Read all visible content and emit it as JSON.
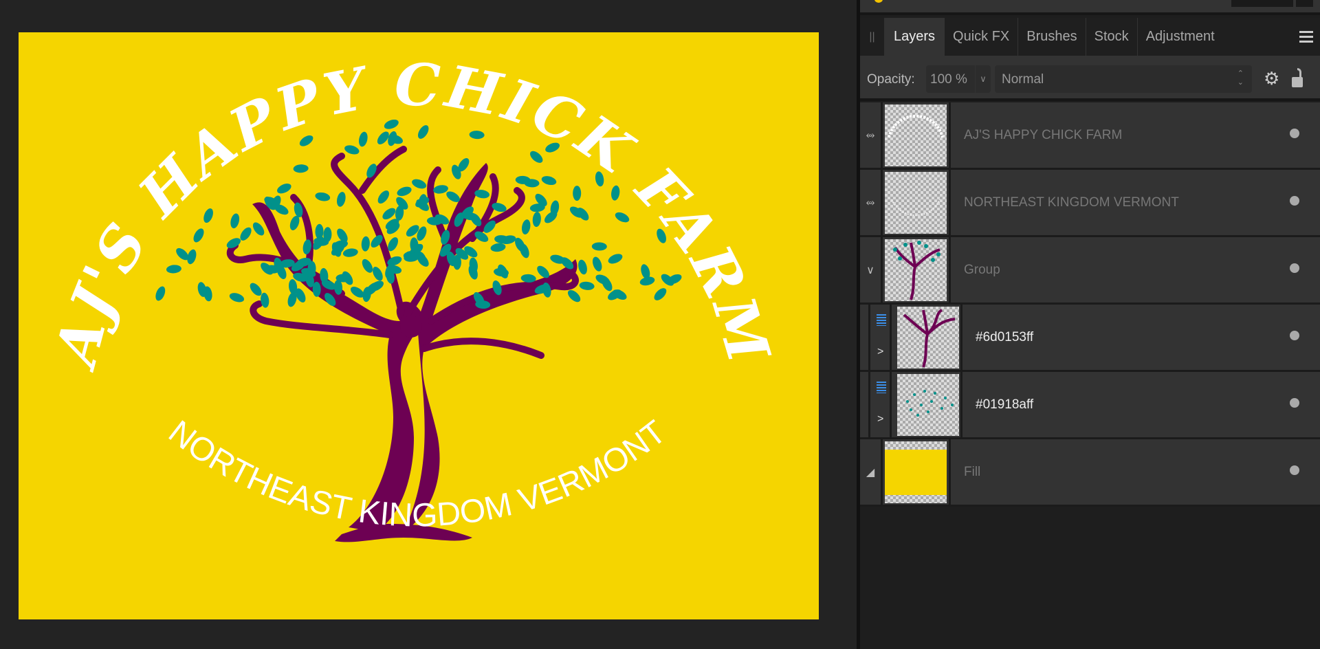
{
  "canvas": {
    "title_text": "AJ'S HAPPY CHICK FARM",
    "subtitle_text": "NORTHEAST KINGDOM VERMONT",
    "colors": {
      "background": "#f5d500",
      "trunk": "#6d0153",
      "leaves": "#01918a",
      "text": "#ffffff"
    }
  },
  "panel": {
    "tabs": [
      {
        "label": "Layers",
        "active": true
      },
      {
        "label": "Quick FX"
      },
      {
        "label": "Brushes"
      },
      {
        "label": "Stock"
      },
      {
        "label": "Adjustment"
      }
    ],
    "opacity_label": "Opacity:",
    "opacity_value": "100 %",
    "blend_mode": "Normal",
    "layers": [
      {
        "name": "AJ'S HAPPY CHICK FARM",
        "type": "curved-text"
      },
      {
        "name": "NORTHEAST KINGDOM VERMONT",
        "type": "curved-text"
      },
      {
        "name": "Group",
        "type": "group",
        "expanded": true
      },
      {
        "name": "#6d0153ff",
        "type": "pixel",
        "child": true
      },
      {
        "name": "#01918aff",
        "type": "pixel",
        "child": true
      },
      {
        "name": "Fill",
        "type": "fill"
      }
    ]
  }
}
